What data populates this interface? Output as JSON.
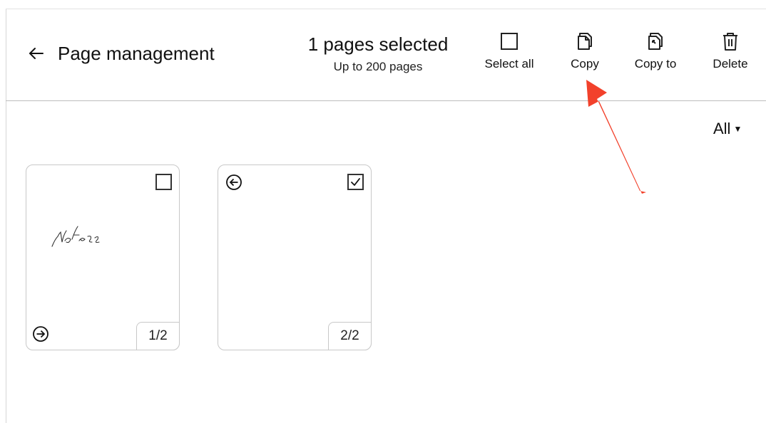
{
  "header": {
    "title": "Page management",
    "selection_count": "1 pages selected",
    "selection_limit": "Up to 200 pages"
  },
  "toolbar": {
    "select_all_label": "Select all",
    "copy_label": "Copy",
    "copy_to_label": "Copy to",
    "delete_label": "Delete"
  },
  "filter": {
    "selected": "All"
  },
  "pages": [
    {
      "page_label": "1/2",
      "selected": false,
      "handwriting": "Notes"
    },
    {
      "page_label": "2/2",
      "selected": true
    }
  ],
  "annotation": {
    "arrow_color": "#f2412b"
  }
}
